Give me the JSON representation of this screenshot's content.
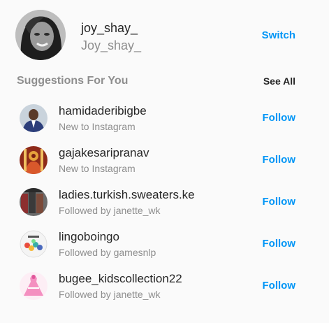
{
  "profile": {
    "username": "joy_shay_",
    "full_name": "Joy_shay_",
    "switch_label": "Switch",
    "avatar_icon": "profile-photo"
  },
  "suggestions": {
    "title": "Suggestions For You",
    "see_all_label": "See All",
    "items": [
      {
        "username": "hamidaderibigbe",
        "subtitle": "New to Instagram",
        "action": "Follow"
      },
      {
        "username": "gajakesaripranav",
        "subtitle": "New to Instagram",
        "action": "Follow"
      },
      {
        "username": "ladies.turkish.sweaters.ke",
        "subtitle": "Followed by janette_wk",
        "action": "Follow"
      },
      {
        "username": "lingoboingo",
        "subtitle": "Followed by gamesnlp",
        "action": "Follow"
      },
      {
        "username": "bugee_kidscollection22",
        "subtitle": "Followed by janette_wk",
        "action": "Follow"
      }
    ]
  },
  "colors": {
    "link_blue": "#0095f6",
    "primary_text": "#262626",
    "secondary_text": "#8e8e8e",
    "background": "#fafafa"
  }
}
